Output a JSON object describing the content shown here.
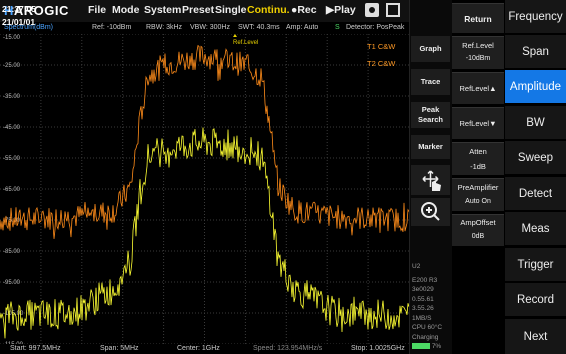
{
  "menu": {
    "logo_a": "H",
    "logo_b": "AROGIC",
    "file": "File",
    "mode": "Mode",
    "system": "System",
    "preset": "Preset",
    "single": "Single",
    "continu": "Continu.",
    "rec": "●Rec",
    "play": "▶Play"
  },
  "status": {
    "unit": "Spectrum(dBm)",
    "ref": "Ref: -10dBm",
    "rbw": "RBW: 3kHz",
    "vbw": "VBW: 300Hz",
    "swt": "SWT: 40.3ms",
    "amp": "Amp: Auto",
    "s": "S",
    "detector": "Detector: PosPeak"
  },
  "plot": {
    "y_ticks": [
      "-15.00",
      "-25.00",
      "-35.00",
      "-45.00",
      "-55.00",
      "-65.00",
      "-75.00",
      "-85.00",
      "-95.00",
      "-105.00",
      "-115.00"
    ],
    "ref_marker": "Ref.Level",
    "trace1_label": "T1 C&W",
    "trace2_label": "T2 C&W",
    "trace1_color": "#ff8c1a",
    "trace2_color": "#ffff33"
  },
  "chart_data": {
    "type": "line",
    "xlabel": "",
    "ylabel": "",
    "ylim": [
      -115,
      -15
    ],
    "xlim_mhz": [
      997.5,
      1002.5
    ],
    "series": [
      {
        "name": "T1 C&W",
        "x": [
          997.5,
          998.4,
          998.9,
          999.1,
          999.2,
          999.3,
          999.5,
          1000.0,
          1000.5,
          1000.7,
          1000.8,
          1000.9,
          1001.1,
          1001.6,
          1002.5
        ],
        "values": [
          -75,
          -74,
          -72,
          -64,
          -45,
          -29,
          -25,
          -22,
          -25,
          -29,
          -45,
          -64,
          -72,
          -74,
          -75
        ]
      },
      {
        "name": "T2 C&W",
        "x": [
          997.5,
          998.4,
          998.9,
          999.1,
          999.2,
          999.3,
          999.5,
          1000.0,
          1000.5,
          1000.7,
          1000.8,
          1000.9,
          1001.1,
          1001.6,
          1002.5
        ],
        "values": [
          -106,
          -105,
          -97,
          -88,
          -68,
          -55,
          -52,
          -50,
          -52,
          -55,
          -68,
          -88,
          -97,
          -105,
          -106
        ]
      }
    ]
  },
  "bottom": {
    "start": "Start: 997.5MHz",
    "span": "Span: 5MHz",
    "center": "Center: 1GHz",
    "speed": "Speed: 123.954MHz/s",
    "stop": "Stop: 1.0025GHz"
  },
  "clock": {
    "time": "21:37:05",
    "date": "21/01/01"
  },
  "left_buttons": {
    "graph": "Graph",
    "trace": "Trace",
    "peak_search": "Peak Search",
    "marker": "Marker"
  },
  "info": {
    "lines": [
      "U2",
      "E200 R3",
      "3e0029",
      "0.55.61",
      "3.55.26",
      "1MB/S",
      "CPU 60°C",
      "Charging",
      "7%"
    ]
  },
  "mid_buttons": {
    "return": "Return",
    "ref_level_label": "Ref.Level",
    "ref_level_value": "-10dBm",
    "ref_up": "RefLevel▲",
    "ref_down": "RefLevel▼",
    "atten_label": "Atten",
    "atten_value": "-1dB",
    "preamp_label": "PreAmplifier",
    "preamp_value": "Auto On",
    "ampoffset_label": "AmpOffset",
    "ampoffset_value": "0dB"
  },
  "right_menu": {
    "items": [
      "Frequency",
      "Span",
      "Amplitude",
      "BW",
      "Sweep",
      "Detect",
      "Meas",
      "Trigger",
      "Record",
      "Next"
    ],
    "active": "Amplitude"
  }
}
